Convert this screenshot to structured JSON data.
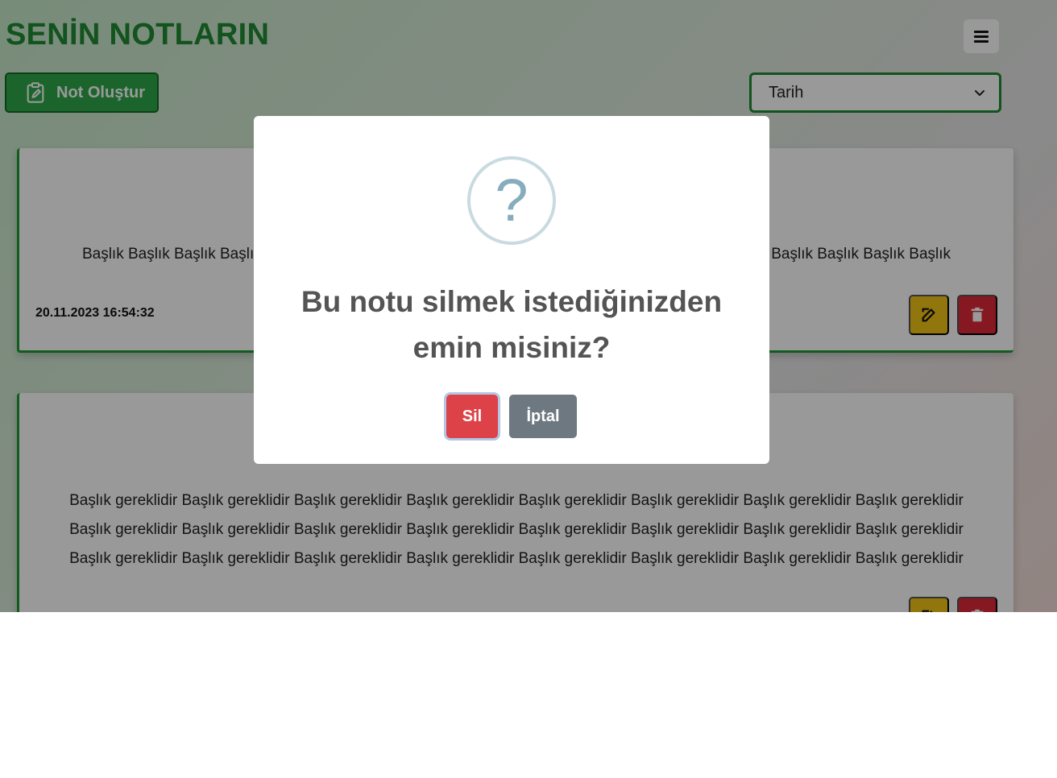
{
  "header": {
    "title": "SENİN NOTLARIN"
  },
  "toolbar": {
    "create_label": "Not Oluştur",
    "sort_selected": "Tarih"
  },
  "notes": [
    {
      "text": "Başlık Başlık Başlık Başlık Başlık Başlık Başlık Başlık Başlık Başlık Başlık Başlık Başlık Başlık Başlık Başlık Başlık Başlık Başlık Başlık",
      "date": "20.11.2023 16:54:32"
    },
    {
      "text": "Başlık gereklidir Başlık gereklidir Başlık gereklidir Başlık gereklidir Başlık gereklidir Başlık gereklidir Başlık gereklidir Başlık gereklidir Başlık gereklidir Başlık gereklidir Başlık gereklidir Başlık gereklidir Başlık gereklidir Başlık gereklidir Başlık gereklidir Başlık gereklidir Başlık gereklidir Başlık gereklidir Başlık gereklidir Başlık gereklidir Başlık gereklidir Başlık gereklidir Başlık gereklidir Başlık gereklidir"
    }
  ],
  "dialog": {
    "icon": "question-icon",
    "icon_glyph": "?",
    "title": "Bu notu silmek istediğinizden emin misiniz?",
    "confirm_label": "Sil",
    "cancel_label": "İptal"
  },
  "colors": {
    "brand_green": "#1e8a32",
    "danger": "#dc4248",
    "warning": "#f2c518",
    "secondary": "#6e7881"
  }
}
